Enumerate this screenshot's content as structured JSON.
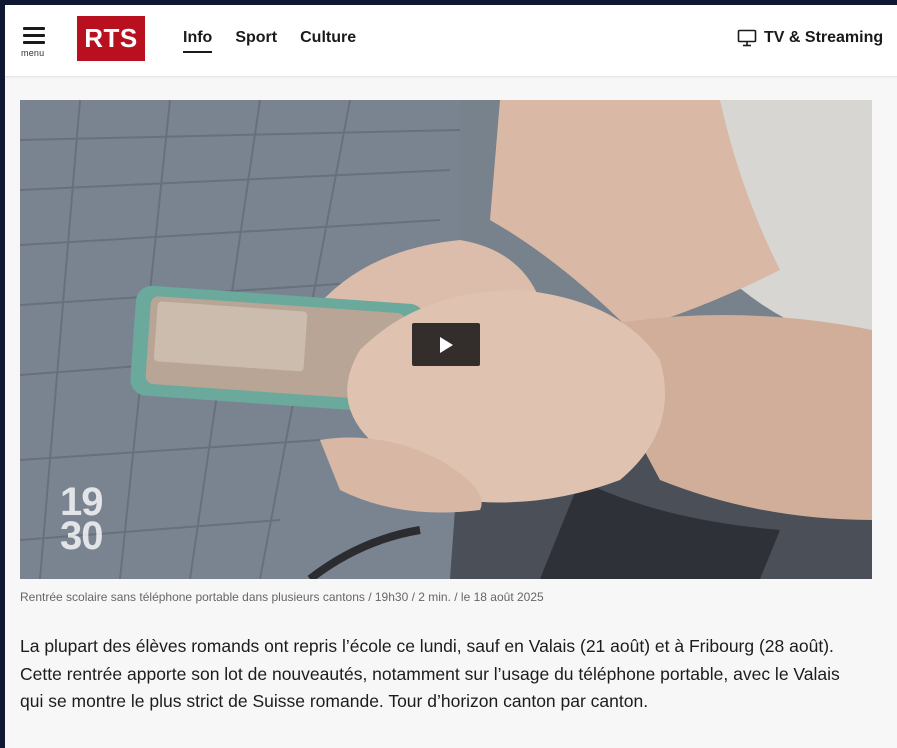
{
  "header": {
    "menu_label": "menu",
    "logo_text": "RTS",
    "nav": [
      {
        "label": "Info",
        "active": true
      },
      {
        "label": "Sport",
        "active": false
      },
      {
        "label": "Culture",
        "active": false
      }
    ],
    "tv_label": "TV & Streaming"
  },
  "video": {
    "badge_top": "19",
    "badge_bottom": "30",
    "caption": "Rentrée scolaire sans téléphone portable dans plusieurs cantons / 19h30 / 2 min. / le 18 août 2025"
  },
  "article": {
    "lead": "La plupart des élèves romands ont repris l’école ce lundi, sauf en Valais (21 août) et à Fribourg (28 août). Cette rentrée apporte son lot de nouveautés, notamment sur l’usage du téléphone portable, avec le Valais qui se montre le plus strict de Suisse romande. Tour d’horizon canton par canton."
  },
  "colors": {
    "brand": "#b8101f",
    "outer_background": "#0f1733",
    "page_background": "#f7f7f7"
  },
  "icons": [
    "menu-icon",
    "tv-icon",
    "play-icon"
  ]
}
